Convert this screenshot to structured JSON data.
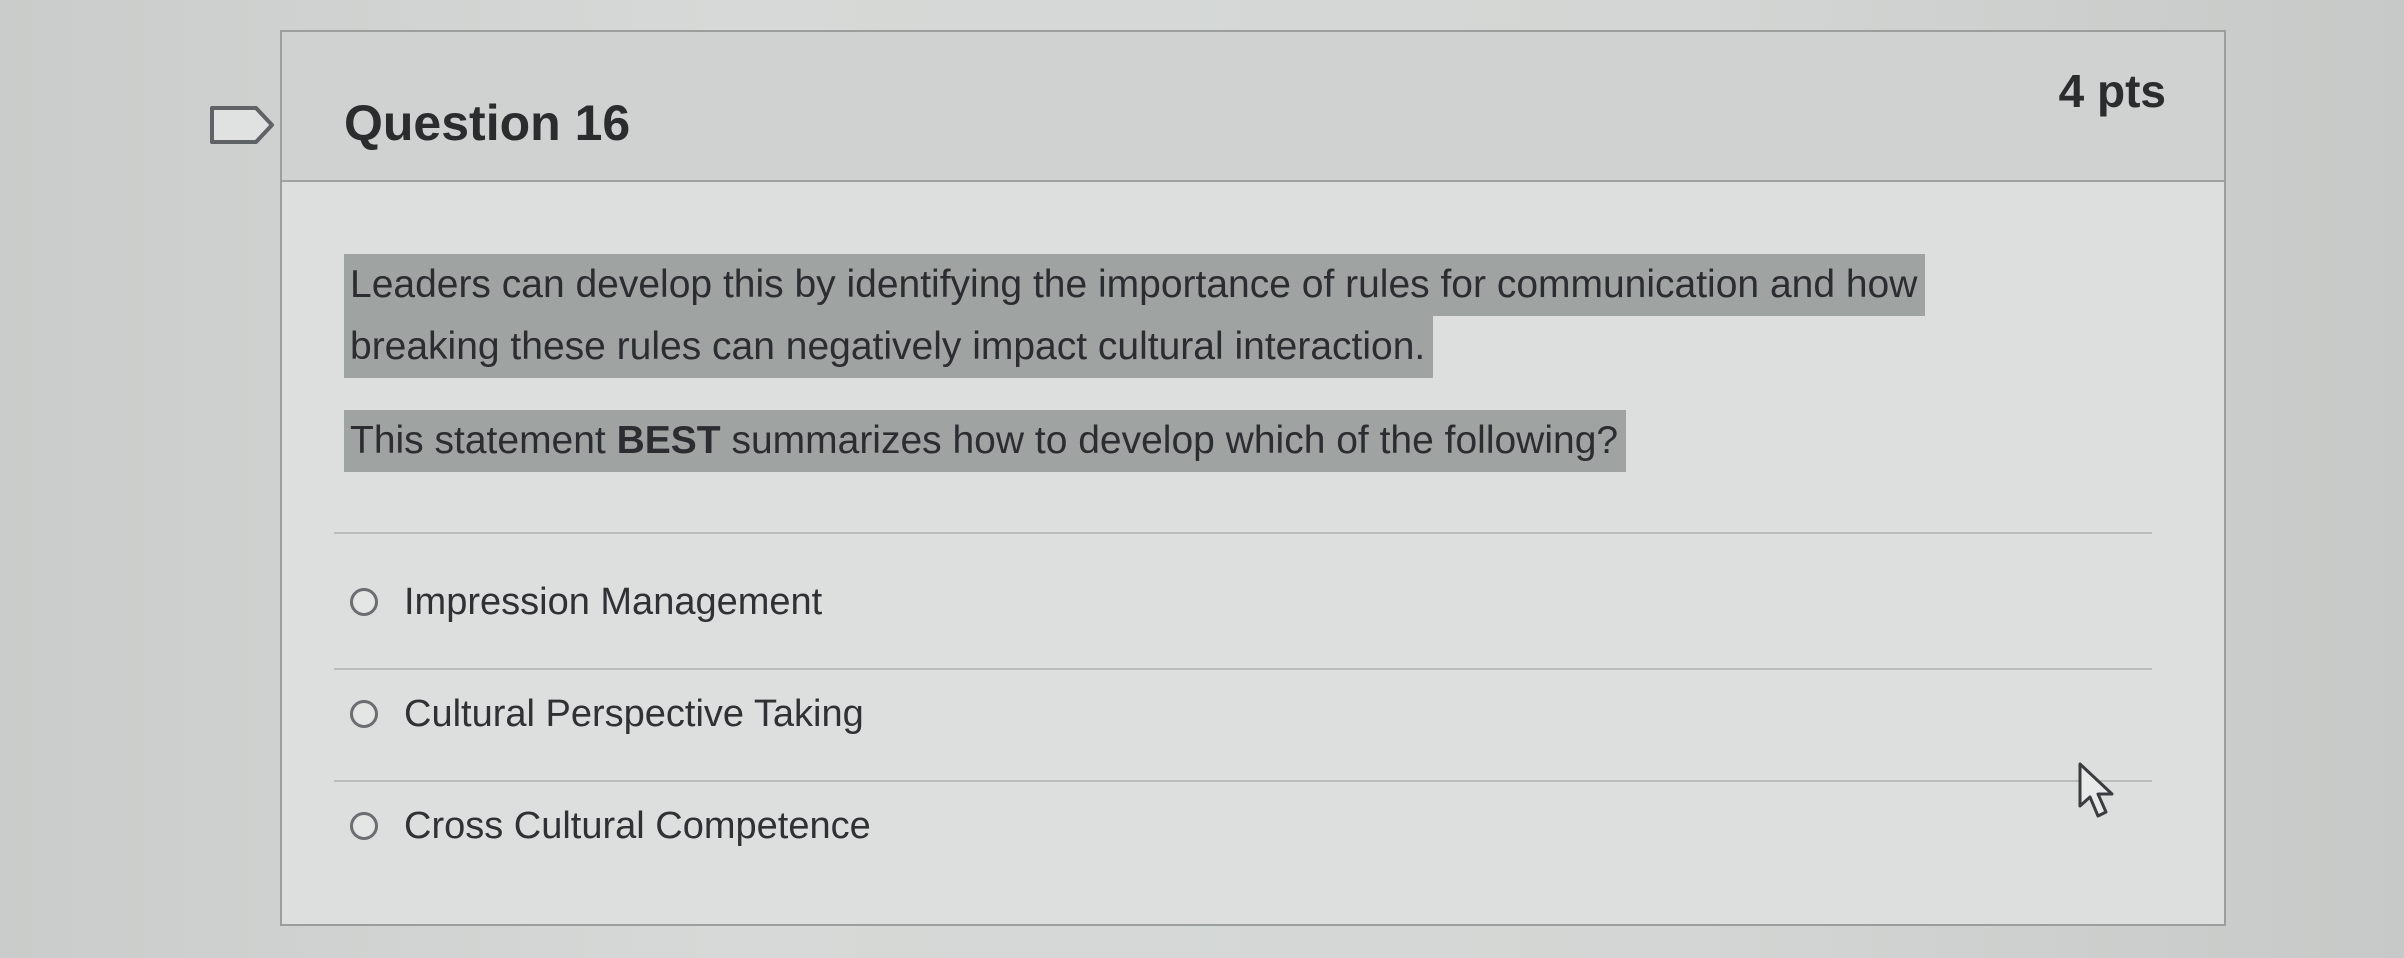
{
  "question": {
    "title": "Question 16",
    "points": "4 pts",
    "statement": {
      "line1": "Leaders can develop this by identifying the importance of rules for communication and how",
      "line2": "breaking these rules can negatively impact cultural interaction."
    },
    "prompt": {
      "before": "This statement ",
      "emphasis": "BEST",
      "after": " summarizes how to develop which of the following?"
    },
    "answers": [
      {
        "label": "Impression Management",
        "selected": false
      },
      {
        "label": "Cultural Perspective Taking",
        "selected": false
      },
      {
        "label": "Cross Cultural Competence",
        "selected": false
      }
    ]
  },
  "icons": {
    "flag": "flag-outline-icon",
    "cursor": "mouse-pointer-icon"
  },
  "colors": {
    "highlight": "#9fa3a1",
    "text": "#2b2c2e",
    "radio_border": "#6a6e70"
  }
}
